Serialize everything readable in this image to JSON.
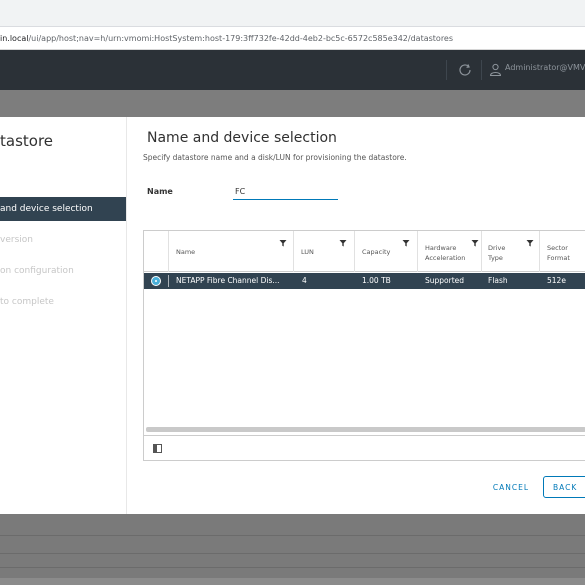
{
  "browser": {
    "url_host": "in.local",
    "url_path": "/ui/app/host;nav=h/urn:vmomi:HostSystem:host-179:3ff732fe-42dd-4eb2-bc5c-6572c585e342/datastores"
  },
  "header": {
    "user": "Administrator@VMV",
    "refresh_icon": "refresh-icon",
    "user_icon": "user-icon"
  },
  "wizard": {
    "title": "tastore",
    "steps": [
      {
        "label": ""
      },
      {
        "label": "and device selection"
      },
      {
        "label": "version"
      },
      {
        "label": "on configuration"
      },
      {
        "label": "to complete"
      }
    ]
  },
  "page": {
    "title": "Name and device selection",
    "subtitle": "Specify datastore name and a disk/LUN for provisioning the datastore.",
    "name_label": "Name",
    "name_value": "FC"
  },
  "grid": {
    "columns": [
      {
        "label": "Name"
      },
      {
        "label": "LUN"
      },
      {
        "label": "Capacity"
      },
      {
        "label": "Hardware Acceleration"
      },
      {
        "label": "Drive Type"
      },
      {
        "label": "Sector Format"
      }
    ],
    "rows": [
      {
        "name": "NETAPP Fibre Channel Dis...",
        "lun": "4",
        "capacity": "1.00 TB",
        "hardware_acceleration": "Supported",
        "drive_type": "Flash",
        "sector_format": "512e"
      }
    ]
  },
  "buttons": {
    "cancel": "CANCEL",
    "back": "BACK"
  },
  "colors": {
    "accent": "#0079b8",
    "selected_row": "#314351",
    "header_bg": "#2b3137"
  }
}
